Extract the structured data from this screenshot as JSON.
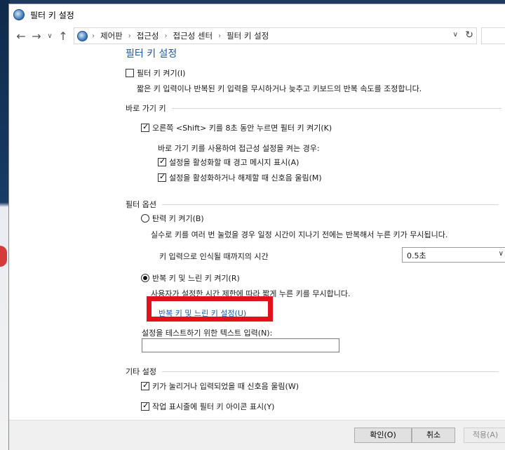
{
  "window": {
    "title": "필터 키 설정"
  },
  "address": {
    "crumbs": [
      "제어판",
      "접근성",
      "접근성 센터",
      "필터 키 설정"
    ]
  },
  "page": {
    "heading": "필터 키 설정",
    "filter_keys_on": {
      "label": "필터 키 켜기(I)",
      "checked": false
    },
    "filter_keys_desc": "짧은 키 입력이나 반복된 키 입력을 무시하거나 늦추고 키보드의 반복 속도를 조정합니다.",
    "shortcut": {
      "group_label": "바로 가기 키",
      "right_shift": {
        "label": "오른쪽 <Shift> 키를 8초 동안 누르면 필터 키 켜기(K)",
        "checked": true
      },
      "subtext": "바로 가기 키를 사용하여 접근성 설정을 켜는 경우:",
      "warning_msg": {
        "label": "설정을 활성화할 때 경고 메시지 표시(A)",
        "checked": true
      },
      "sound": {
        "label": "설정을 활성화하거나 해제할 때 신호음 울림(M)",
        "checked": true
      }
    },
    "filter_options": {
      "group_label": "필터 옵션",
      "bounce_keys": {
        "label": "탄력 키 켜기(B)",
        "selected": false
      },
      "bounce_desc": "실수로 키를 여러 번 눌렀을 경우 일정 시간이 지나기 전에는 반복해서 누른 키가 무시됩니다.",
      "time_label": "키 입력으로 인식될 때까지의 시간",
      "time_value": "0.5초",
      "repeat_keys": {
        "label": "반복 키 및 느린 키 켜기(R)",
        "selected": true
      },
      "repeat_desc": "사용자가 설정한 시간 제한에 따라 짧게 누른 키를 무시합니다.",
      "repeat_link": "반복 키 및 느린 키 설정(U)",
      "test_label": "설정을 테스트하기 위한 텍스트 입력(N):",
      "test_value": ""
    },
    "other": {
      "group_label": "기타 설정",
      "beep": {
        "label": "키가 눌리거나 입력되었을 때 신호음 울림(W)",
        "checked": true
      },
      "taskbar_icon": {
        "label": "작업 표시줄에 필터 키 아이콘 표시(Y)",
        "checked": true
      }
    }
  },
  "footer": {
    "ok": "확인(O)",
    "cancel": "취소",
    "apply": "적용(A)"
  },
  "colors": {
    "heading": "#1c5aa6",
    "highlight": "#e3121a"
  },
  "icons": [
    "back-arrow-icon",
    "forward-arrow-icon",
    "up-arrow-icon",
    "control-panel-icon",
    "chevron-right-icon",
    "chevron-down-icon",
    "refresh-icon"
  ]
}
